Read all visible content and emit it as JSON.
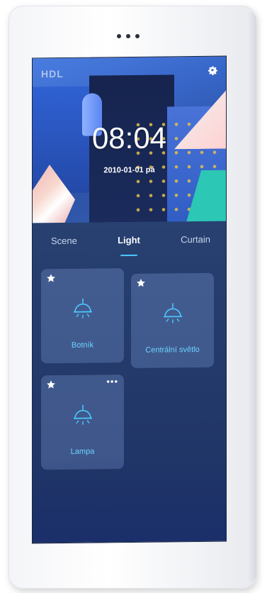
{
  "screen": {
    "logo": "HDL",
    "clock": {
      "time": "08:04",
      "date": "2010-01-01  pá"
    },
    "settings_icon": "gear-icon"
  },
  "tabs": [
    {
      "label": "Scene",
      "active": false
    },
    {
      "label": "Light",
      "active": true
    },
    {
      "label": "Curtain",
      "active": false
    }
  ],
  "devices": [
    {
      "label": "Botník",
      "icon": "ceiling-lamp-icon",
      "favorite": true
    },
    {
      "label": "Centrální světlo",
      "icon": "ceiling-lamp-icon",
      "favorite": true
    },
    {
      "label": "Lampa",
      "icon": "ceiling-lamp-icon",
      "favorite": true,
      "more_label": "•••"
    }
  ],
  "colors": {
    "accent": "#4bc8ff",
    "label": "#6bd3ff",
    "background": "#263e6e"
  }
}
